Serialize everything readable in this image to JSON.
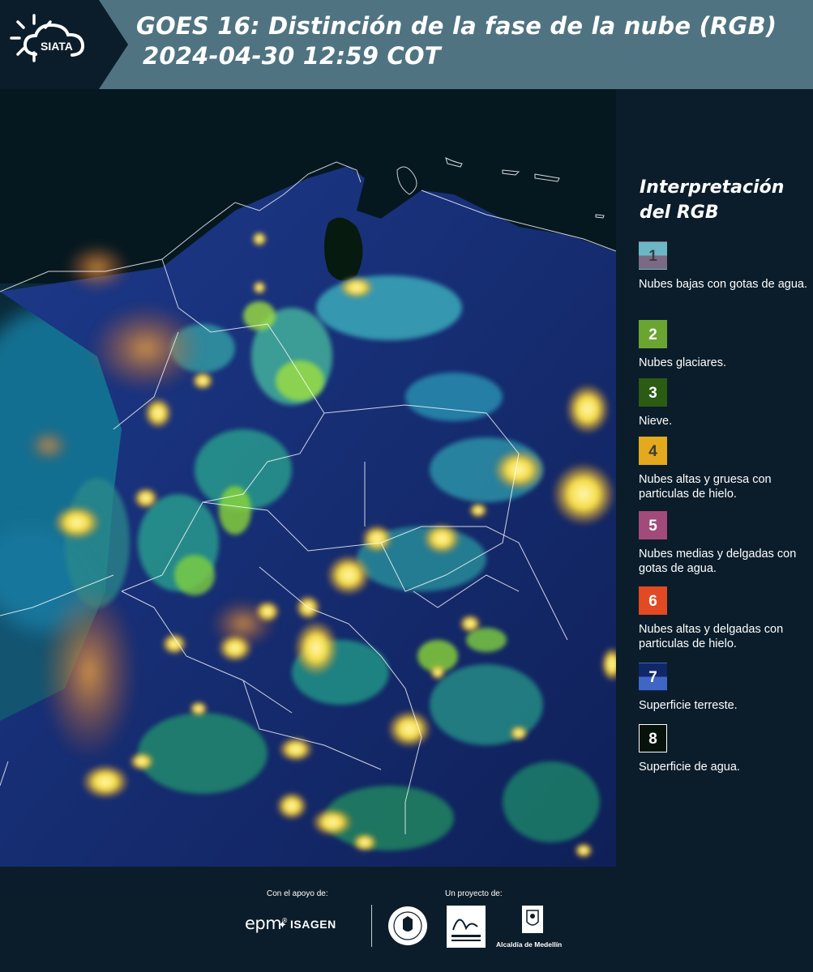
{
  "header": {
    "logo_text": "SIATA",
    "title_line1": "GOES 16: Distinción de la fase de la nube (RGB)",
    "title_line2": "2024-04-30 12:59 COT",
    "background_color": "#4f7381"
  },
  "map": {
    "image_description_icon": "satellite-rgb-map",
    "ocean_color": "#061a22",
    "land_color": "#142a6e"
  },
  "legend": {
    "title": "Interpretación del RGB",
    "items": [
      {
        "number": "1",
        "label": "Nubes bajas con gotas de agua.",
        "color_top": "#6cb7c6",
        "color_bottom": "#7a6a86",
        "text_color": "#3c3c3c"
      },
      {
        "number": "2",
        "label": "Nubes glaciares.",
        "color": "#6aa531",
        "text_color": "#ffffff"
      },
      {
        "number": "3",
        "label": "Nieve.",
        "color": "#2c5b14",
        "text_color": "#ffffff"
      },
      {
        "number": "4",
        "label": "Nubes altas y gruesa con particulas de hielo.",
        "color": "#e2aa1c",
        "text_color": "#3a3a3a"
      },
      {
        "number": "5",
        "label": "Nubes medias y delgadas con gotas de agua.",
        "color": "#a24a7a",
        "text_color": "#ffffff"
      },
      {
        "number": "6",
        "label": "Nubes altas y delgadas con particulas de hielo.",
        "color": "#e24a24",
        "text_color": "#ffffff"
      },
      {
        "number": "7",
        "label": "Superficie terreste.",
        "color_top": "#10276a",
        "color_bottom": "#3f66c4",
        "text_color": "#ffffff"
      },
      {
        "number": "8",
        "label": "Superficie de agua.",
        "color": "#06130b",
        "text_color": "#ffffff",
        "border_color": "#ffffff"
      }
    ]
  },
  "footer": {
    "support_label": "Con el apoyo de:",
    "project_label": "Un proyecto de:",
    "epm_text": "epm",
    "isagen_text": "ISAGEN",
    "alcaldia_text": "Alcaldía de Medellín"
  }
}
